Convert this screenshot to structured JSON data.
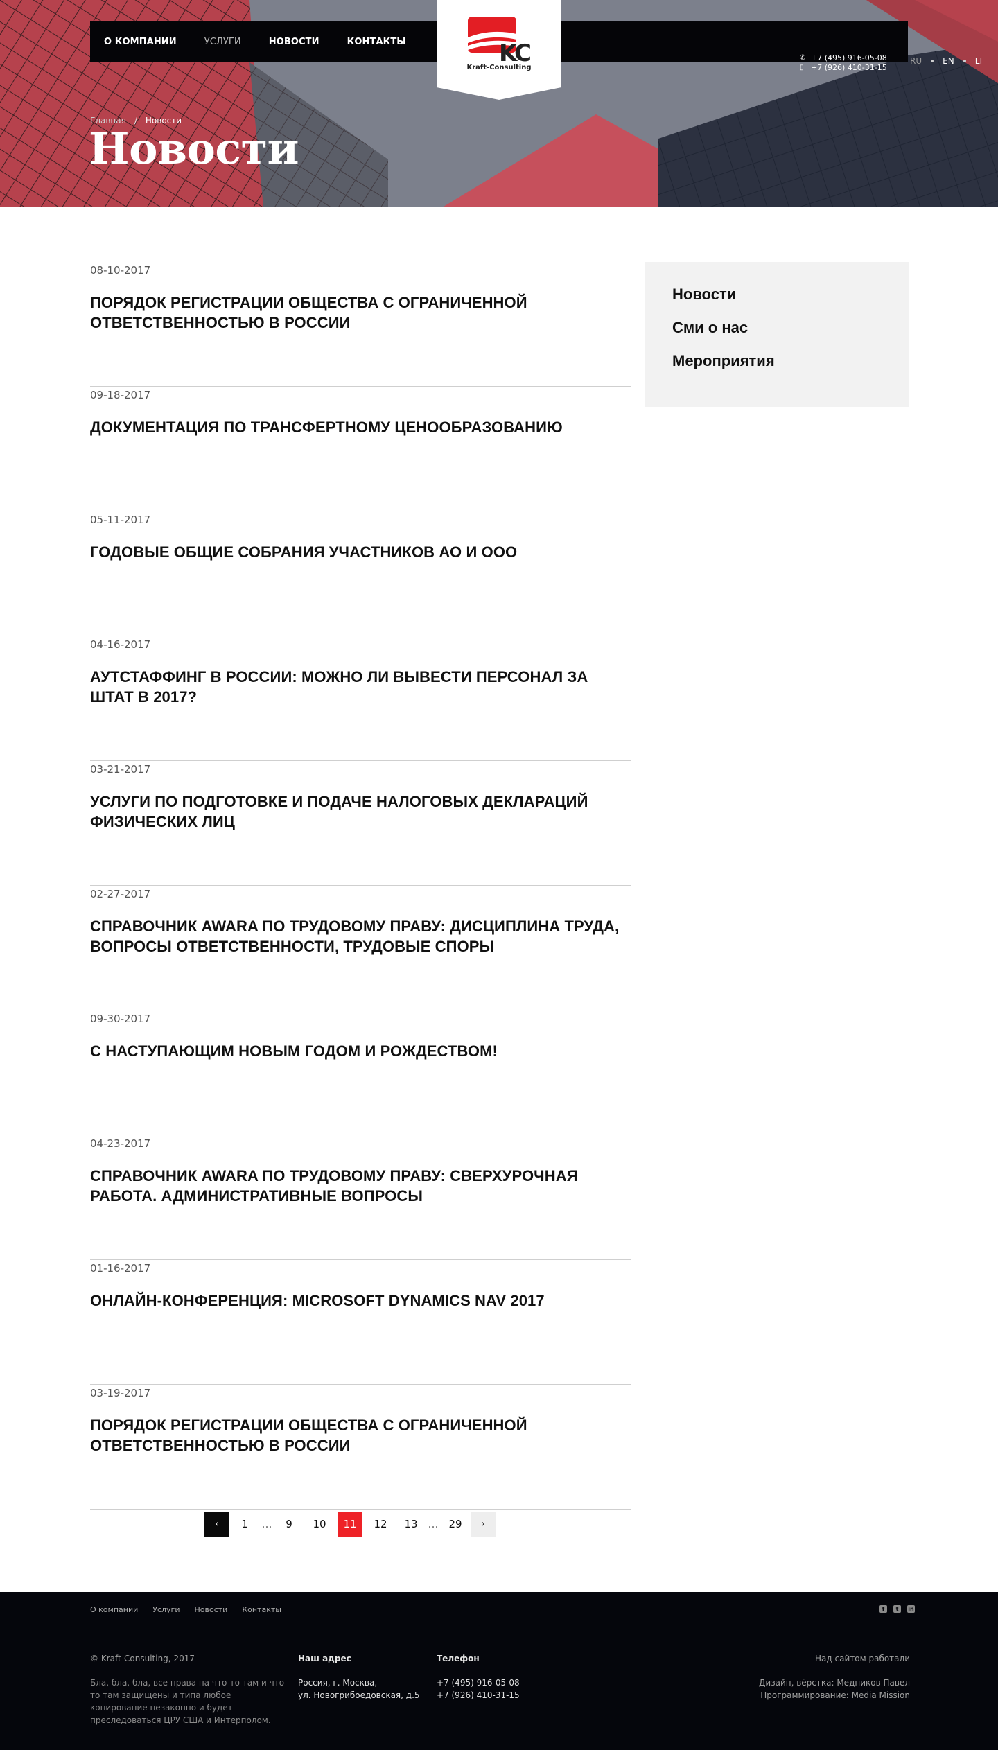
{
  "header": {
    "nav": [
      "О КОМПАНИИ",
      "УСЛУГИ",
      "НОВОСТИ",
      "КОНТАКТЫ"
    ],
    "logo_caption": "Kraft-Consulting",
    "phones": [
      "+7 (495) 916-05-08",
      "+7 (926) 410-31-15"
    ],
    "languages": [
      "RU",
      "EN",
      "LT"
    ],
    "active_language": "RU"
  },
  "breadcrumb": {
    "home": "Главная",
    "separator": "/",
    "current": "Новости"
  },
  "page_title": "Новости",
  "news": [
    {
      "date": "08-10-2017",
      "title": "ПОРЯДОК РЕГИСТРАЦИИ ОБЩЕСТВА С ОГРАНИЧЕННОЙ ОТВЕТСТВЕННОСТЬЮ В РОССИИ"
    },
    {
      "date": "09-18-2017",
      "title": "ДОКУМЕНТАЦИЯ ПО ТРАНСФЕРТНОМУ ЦЕНООБРАЗОВАНИЮ"
    },
    {
      "date": "05-11-2017",
      "title": "ГОДОВЫЕ ОБЩИЕ СОБРАНИЯ УЧАСТНИКОВ АО И ООО"
    },
    {
      "date": "04-16-2017",
      "title": "АУТСТАФФИНГ В РОССИИ: МОЖНО ЛИ ВЫВЕСТИ ПЕРСОНАЛ ЗА ШТАТ В 2017?"
    },
    {
      "date": "03-21-2017",
      "title": "УСЛУГИ ПО ПОДГОТОВКЕ И ПОДАЧЕ НАЛОГОВЫХ ДЕКЛАРАЦИЙ ФИЗИЧЕСКИХ ЛИЦ"
    },
    {
      "date": "02-27-2017",
      "title": "СПРАВОЧНИК AWARA ПО ТРУДОВОМУ ПРАВУ: ДИСЦИПЛИНА ТРУДА, ВОПРОСЫ ОТВЕТСТВЕННОСТИ, ТРУДОВЫЕ СПОРЫ"
    },
    {
      "date": "09-30-2017",
      "title": "С НАСТУПАЮЩИМ НОВЫМ ГОДОМ И РОЖДЕСТВОМ!"
    },
    {
      "date": "04-23-2017",
      "title": "СПРАВОЧНИК AWARA ПО ТРУДОВОМУ ПРАВУ: СВЕРХУРОЧНАЯ РАБОТА. АДМИНИСТРАТИВНЫЕ ВОПРОСЫ"
    },
    {
      "date": "01-16-2017",
      "title": "ОНЛАЙН-КОНФЕРЕНЦИЯ: MICROSOFT DYNAMICS NAV 2017"
    },
    {
      "date": "03-19-2017",
      "title": "ПОРЯДОК РЕГИСТРАЦИИ ОБЩЕСТВА С ОГРАНИЧЕННОЙ ОТВЕТСТВЕННОСТЬЮ В РОССИИ"
    }
  ],
  "sidebar": {
    "items": [
      "Новости",
      "Сми о нас",
      "Мероприятия"
    ]
  },
  "pagination": {
    "prev": "‹",
    "next": "›",
    "ellipsis": "…",
    "pages": [
      "1",
      "9",
      "10",
      "11",
      "12",
      "13",
      "29"
    ],
    "current": "11"
  },
  "footer": {
    "nav": [
      "О компании",
      "Услуги",
      "Новости",
      "Контакты"
    ],
    "social_icons": [
      "facebook-icon",
      "twitter-icon",
      "linkedin-icon"
    ],
    "copyright": "© Kraft-Consulting, 2017",
    "rights": "Бла, бла, бла, все права на что-то там и что-то там защищены и типа любое копирование незаконно и будет преследоваться ЦРУ США и Интерполом.",
    "address_heading": "Наш адрес",
    "address_lines": [
      "Россия, г. Москва,",
      "ул. Новогрибоедовская, д.5"
    ],
    "phone_heading": "Телефон",
    "phone_lines": [
      "+7 (495) 916-05-08",
      "+7 (926) 410-31-15"
    ],
    "credits_heading": "Над сайтом работали",
    "credits_lines": [
      "Дизайн, вёрстка: Медников Павел",
      "Программирование: Media Mission"
    ]
  },
  "colors": {
    "accent": "#ee2227",
    "dark": "#050508",
    "sidebar_bg": "#f2f2f2"
  }
}
